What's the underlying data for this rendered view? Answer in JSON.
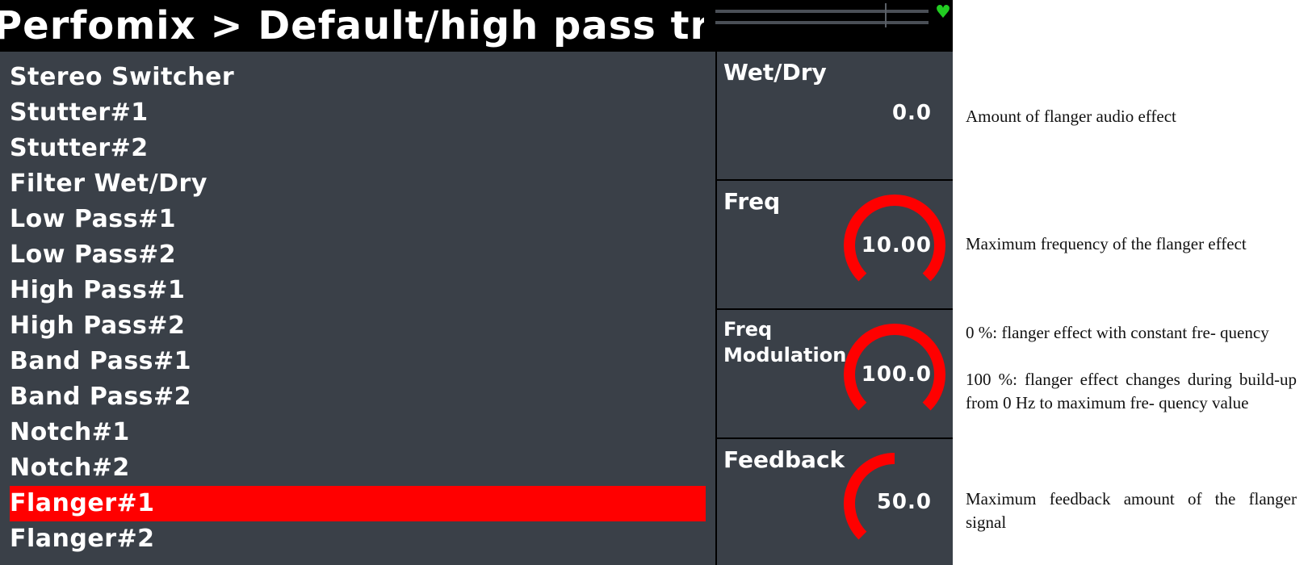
{
  "title": "Perfomix > Default/high pass tran",
  "effects": [
    {
      "label": "Stereo Switcher",
      "selected": false
    },
    {
      "label": "Stutter#1",
      "selected": false
    },
    {
      "label": "Stutter#2",
      "selected": false
    },
    {
      "label": "Filter Wet/Dry",
      "selected": false
    },
    {
      "label": "Low Pass#1",
      "selected": false
    },
    {
      "label": "Low Pass#2",
      "selected": false
    },
    {
      "label": "High Pass#1",
      "selected": false
    },
    {
      "label": "High Pass#2",
      "selected": false
    },
    {
      "label": "Band Pass#1",
      "selected": false
    },
    {
      "label": "Band Pass#2",
      "selected": false
    },
    {
      "label": "Notch#1",
      "selected": false
    },
    {
      "label": "Notch#2",
      "selected": false
    },
    {
      "label": "Flanger#1",
      "selected": true
    },
    {
      "label": "Flanger#2",
      "selected": false
    }
  ],
  "params": [
    {
      "label": "Wet/Dry",
      "value": "0.0",
      "knob_level": 0.0
    },
    {
      "label": "Freq",
      "value": "10.00",
      "knob_level": 1.0
    },
    {
      "label_line1": "Freq",
      "label_line2": "Modulation",
      "value": "100.0",
      "knob_level": 1.0
    },
    {
      "label": "Feedback",
      "value": "50.0",
      "knob_level": 0.5
    }
  ],
  "descriptions": [
    "Amount of flanger audio effect",
    "Maximum frequency of the flanger effect",
    "0 %:  flanger effect with constant fre- quency",
    "100 %:  flanger effect changes during build-up from 0 Hz to maximum fre- quency value",
    "Maximum  feedback  amount  of  the flanger signal"
  ],
  "colors": {
    "accent": "#ff0000",
    "background": "#3a4048",
    "titlebar": "#000000",
    "status_ok": "#22cc22"
  },
  "icons": {
    "status": "heart-icon"
  }
}
